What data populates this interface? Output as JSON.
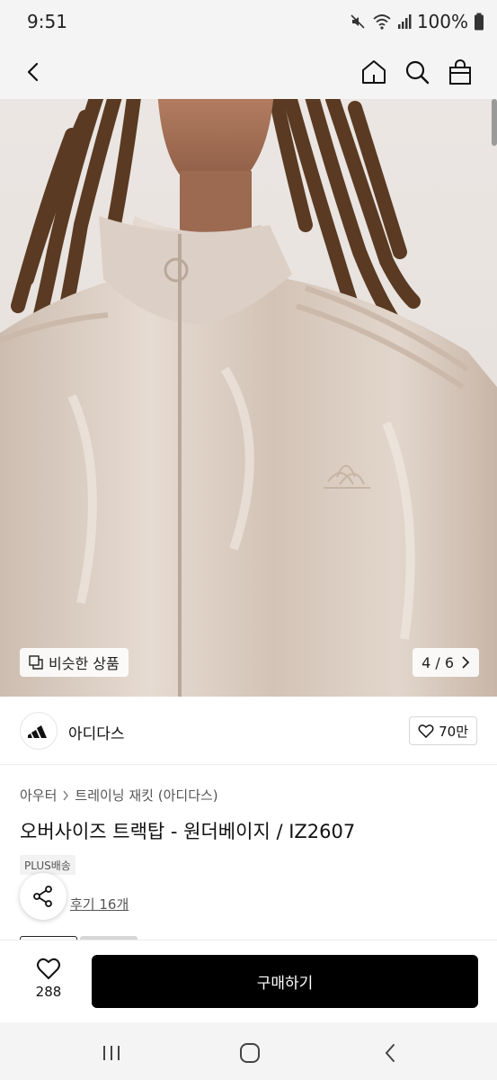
{
  "status_bar": {
    "time": "9:51",
    "battery": "100%"
  },
  "icons": {
    "back": "chevron-left-icon",
    "home": "home-icon",
    "search": "search-icon",
    "cart": "shopping-bag-icon",
    "similar": "similar-items-icon",
    "next": "chevron-right-icon",
    "heart": "heart-icon",
    "share": "share-icon"
  },
  "hero": {
    "similar_label": "비슷한 상품",
    "counter": "4 / 6"
  },
  "brand": {
    "name": "아디다스",
    "likes": "70만"
  },
  "breadcrumb": {
    "category": "아우터",
    "subcategory": "트레이닝 재킷 (아디다스)"
  },
  "product": {
    "title": "오버사이즈 트랙탑 - 원더베이지 / IZ2607",
    "shipping_tag": "PLUS배송",
    "reviews": "후기 16개"
  },
  "bottom_bar": {
    "wishlist_count": "288",
    "buy_label": "구매하기"
  },
  "colors": {
    "accent": "#000000",
    "product_beige": "#d8c9bd",
    "hair": "#5a3a22"
  }
}
